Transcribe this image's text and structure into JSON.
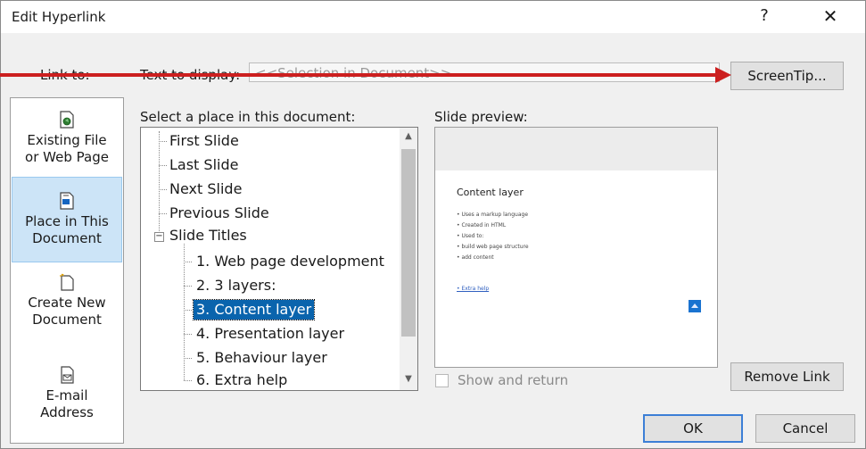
{
  "dialog": {
    "title": "Edit Hyperlink",
    "help_glyph": "?",
    "close_glyph": "✕"
  },
  "link_to": {
    "label": "Link to:",
    "items": [
      {
        "line1": "Existing File",
        "line2": "or Web Page",
        "icon": "web-file-icon",
        "selected": false
      },
      {
        "line1": "Place in This",
        "line2": "Document",
        "icon": "document-place-icon",
        "selected": true
      },
      {
        "line1": "Create New",
        "line2": "Document",
        "icon": "new-document-icon",
        "selected": false
      },
      {
        "line1": "E-mail",
        "line2": "Address",
        "icon": "email-icon",
        "selected": false
      }
    ]
  },
  "text_to_display": {
    "label": "Text to display:",
    "value": "<<Selection in Document>>"
  },
  "screentip_button": "ScreenTip...",
  "place": {
    "label": "Select a place in this document:",
    "items": [
      {
        "text": "First Slide",
        "level": 0
      },
      {
        "text": "Last Slide",
        "level": 0
      },
      {
        "text": "Next Slide",
        "level": 0
      },
      {
        "text": "Previous Slide",
        "level": 0
      },
      {
        "text": "Slide Titles",
        "level": 0,
        "expander": "−"
      },
      {
        "text": "1. Web page development",
        "level": 1
      },
      {
        "text": "2. 3 layers:",
        "level": 1
      },
      {
        "text": "3. Content layer",
        "level": 1,
        "selected": true
      },
      {
        "text": "4. Presentation layer",
        "level": 1
      },
      {
        "text": "5. Behaviour layer",
        "level": 1
      },
      {
        "text": "6. Extra help",
        "level": 1
      }
    ],
    "scroll_up": "▲",
    "scroll_down": "▼"
  },
  "preview": {
    "label": "Slide preview:",
    "slide_title": "Content layer",
    "bullets": [
      "• Uses a markup language",
      "• Created in HTML",
      "• Used to:",
      "• build web page structure",
      "• add content"
    ],
    "link": "• Extra help",
    "accent_color": "#1a73d0"
  },
  "show_and_return": {
    "label": "Show and return",
    "checked": false
  },
  "buttons": {
    "remove_link": "Remove Link",
    "ok": "OK",
    "cancel": "Cancel"
  },
  "annotation": {
    "arrow_color": "#cc1f1f"
  }
}
